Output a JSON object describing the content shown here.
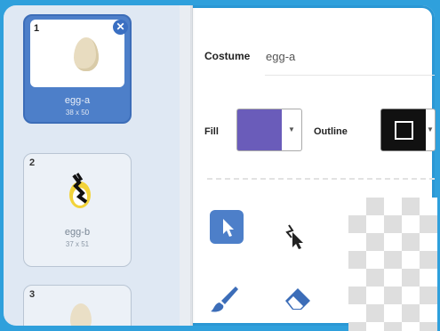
{
  "costumes": [
    {
      "number": "1",
      "name": "egg-a",
      "size": "38 x 50",
      "selected": true
    },
    {
      "number": "2",
      "name": "egg-b",
      "size": "37 x 51",
      "selected": false
    },
    {
      "number": "3",
      "name": "",
      "size": "",
      "selected": false
    }
  ],
  "editor": {
    "costume_label": "Costume",
    "costume_name": "egg-a",
    "fill_label": "Fill",
    "outline_label": "Outline",
    "fill_color": "#6a5cba",
    "outline_color": "#111111"
  },
  "tools": [
    {
      "icon": "arrow-select-icon",
      "active": true
    },
    {
      "icon": "reshape-icon",
      "active": false
    },
    {
      "icon": "brush-icon",
      "active": false
    },
    {
      "icon": "eraser-icon",
      "active": false
    }
  ],
  "colors": {
    "accent": "#4d7fc9",
    "frame": "#2fa0dc"
  }
}
